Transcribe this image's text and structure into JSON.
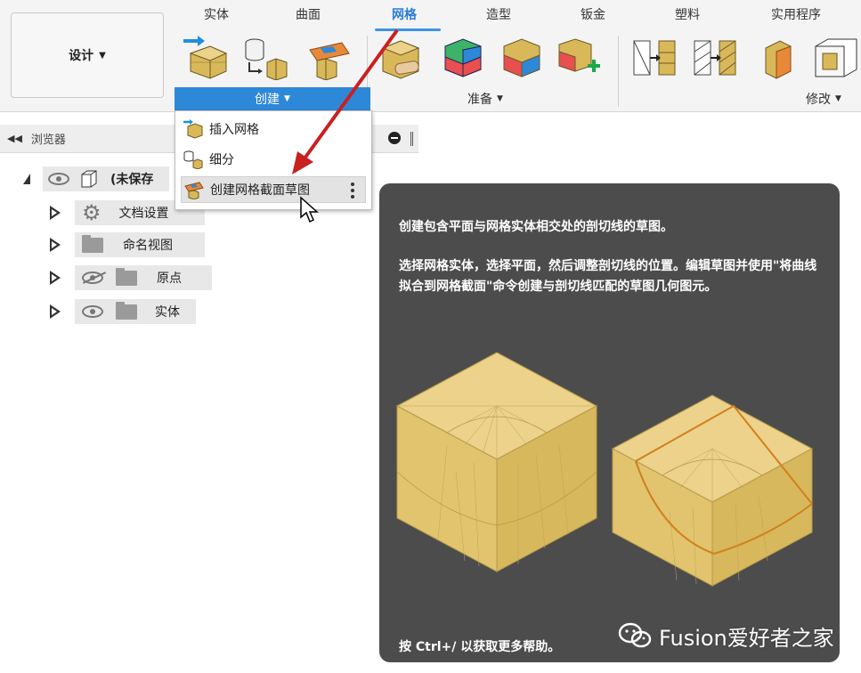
{
  "ribbon": {
    "design_button": "设计",
    "tabs": [
      {
        "label": "实体",
        "active": false
      },
      {
        "label": "曲面",
        "active": false
      },
      {
        "label": "网格",
        "active": true
      },
      {
        "label": "造型",
        "active": false
      },
      {
        "label": "钣金",
        "active": false
      },
      {
        "label": "塑料",
        "active": false
      },
      {
        "label": "实用程序",
        "active": false
      }
    ],
    "groups": {
      "create": "创建",
      "prepare": "准备",
      "modify": "修改"
    },
    "accent_color": "#2e88d8"
  },
  "browser": {
    "title": "浏览器",
    "root_label": "(未保存",
    "items": [
      {
        "label": "文档设置",
        "icon": "gear-icon"
      },
      {
        "label": "命名视图",
        "icon": "folder-icon"
      },
      {
        "label": "原点",
        "icon": "folder-icon",
        "visibility": "hidden"
      },
      {
        "label": "实体",
        "icon": "folder-icon",
        "visibility": "visible"
      }
    ]
  },
  "create_menu": {
    "items": [
      {
        "label": "插入网格",
        "icon": "insert-mesh-icon"
      },
      {
        "label": "细分",
        "icon": "tessellate-icon"
      },
      {
        "label": "创建网格截面草图",
        "icon": "mesh-section-sketch-icon",
        "highlighted": true
      }
    ]
  },
  "tooltip": {
    "description": "创建包含平面与网格实体相交处的剖切线的草图。",
    "instructions": "选择网格实体，选择平面，然后调整剖切线的位置。编辑草图并使用\"将曲线拟合到网格截面\"命令创建与剖切线匹配的草图几何图元。",
    "footer": "按 Ctrl+/ 以获取更多帮助。"
  },
  "watermark": {
    "text": "Fusion爱好者之家"
  }
}
